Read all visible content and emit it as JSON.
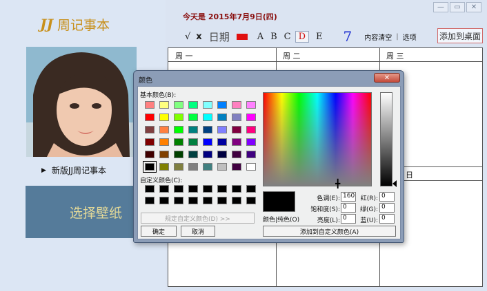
{
  "app": {
    "logo_mark": "JJ",
    "logo_text": "周记事本",
    "today": "今天是 2015年7月9日(四)",
    "promo_link": "新版JJ周记事本",
    "wallpaper_button": "选择壁纸"
  },
  "toolbar": {
    "check": "√",
    "close": "x",
    "date_label": "日期",
    "color_a": "A",
    "color_b": "B",
    "color_c": "C",
    "color_d": "D",
    "color_e": "E",
    "week_number": "7",
    "clear_label": "内容清空",
    "separator": "|",
    "options_label": "选项",
    "add_desktop_label": "添加到桌面"
  },
  "calendar": {
    "days": [
      "周 一",
      "周 二",
      "周 三"
    ],
    "sunday": "日"
  },
  "color_dialog": {
    "title": "颜色",
    "basic_label": "基本颜色(B):",
    "custom_label": "自定义颜色(C):",
    "define_custom_button": "规定自定义颜色(D) >>",
    "ok_button": "确定",
    "cancel_button": "取消",
    "solid_label": "颜色|纯色(O)",
    "hue_label": "色调(E):",
    "hue_value": "160",
    "sat_label": "饱和度(S):",
    "sat_value": "0",
    "lum_label": "亮度(L):",
    "lum_value": "0",
    "red_label": "红(R):",
    "red_value": "0",
    "green_label": "绿(G):",
    "green_value": "0",
    "blue_label": "蓝(U):",
    "blue_value": "0",
    "add_custom_button": "添加到自定义颜色(A)",
    "basic_colors": [
      [
        "#ff8080",
        "#ffff80",
        "#80ff80",
        "#00ff80",
        "#80ffff",
        "#0080ff",
        "#ff80c0",
        "#ff80ff"
      ],
      [
        "#ff0000",
        "#ffff00",
        "#80ff00",
        "#00ff40",
        "#00ffff",
        "#0080c0",
        "#8080c0",
        "#ff00ff"
      ],
      [
        "#804040",
        "#ff8040",
        "#00ff00",
        "#008080",
        "#004080",
        "#8080ff",
        "#800040",
        "#ff0080"
      ],
      [
        "#800000",
        "#ff8000",
        "#008000",
        "#008040",
        "#0000ff",
        "#0000a0",
        "#800080",
        "#8000ff"
      ],
      [
        "#400000",
        "#804000",
        "#004000",
        "#004040",
        "#000080",
        "#000040",
        "#400040",
        "#400080"
      ],
      [
        "#000000",
        "#808000",
        "#808040",
        "#808080",
        "#408080",
        "#c0c0c0",
        "#400040",
        "#ffffff"
      ]
    ]
  }
}
